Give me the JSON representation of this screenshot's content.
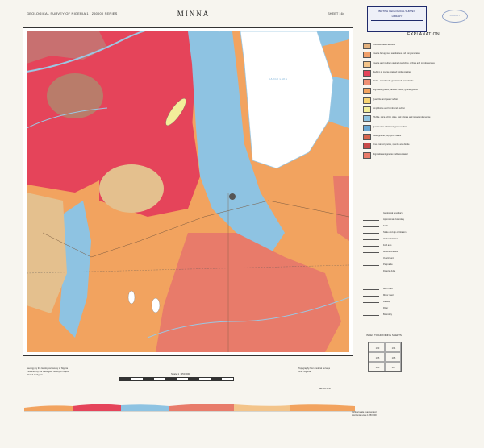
{
  "sheet": {
    "survey_title": "GEOLOGICAL SURVEY OF NIGERIA 1 : 250000 SERIES",
    "map_title": "MINNA",
    "sheet_number": "SHEET 164"
  },
  "stamp": {
    "line1": "BRITISH GEOLOGICAL SURVEY",
    "line2": "LIBRARY",
    "oval_text": "LIBRARY"
  },
  "map": {
    "lake_label": "KAINJI LAKE"
  },
  "explanation": {
    "title": "EXPLANATION",
    "units": [
      {
        "color": "#e4b27e",
        "text": "Unconsolidated alluvium"
      },
      {
        "color": "#f0a06a",
        "text": "Coarse ferruginous sandstones and conglomerates"
      },
      {
        "color": "#f3c48a",
        "text": "Coarse and medium grained quartzites, schists and conglomerates"
      },
      {
        "color": "#e5445a",
        "text": "Medium to coarse grained biotite granites"
      },
      {
        "color": "#ef8f73",
        "text": "Biotite - hornblende granite and granodiorite"
      },
      {
        "color": "#f2a35f",
        "text": "Migmatitic gneiss, banded gneiss, granite gneiss"
      },
      {
        "color": "#f8d472",
        "text": "Quartzite and quartz schist"
      },
      {
        "color": "#f3ee9a",
        "text": "Amphibolite and hornblende schist"
      },
      {
        "color": "#8ec3e2",
        "text": "Phyllite, mica schist, slate, calc silicate and metaconglomerate"
      },
      {
        "color": "#6aa7d3",
        "text": "Quartz mica schist and garnet schist"
      },
      {
        "color": "#d9664f",
        "text": "Older granite porphyritic facies"
      },
      {
        "color": "#c84a4a",
        "text": "Fine grained granite, syenite and diorite"
      },
      {
        "color": "#e87b6a",
        "text": "Migmatite and granite undifferentiated"
      }
    ]
  },
  "symbols": [
    {
      "text": "Geological boundary"
    },
    {
      "text": "Approximate boundary"
    },
    {
      "text": "Fault"
    },
    {
      "text": "Strike and dip of foliation"
    },
    {
      "text": "Vertical foliation"
    },
    {
      "text": "Fold axis"
    },
    {
      "text": "Mineral lineation"
    },
    {
      "text": "Quartz vein"
    },
    {
      "text": "Pegmatite"
    },
    {
      "text": "Dolerite dyke"
    }
  ],
  "roads": [
    {
      "text": "Main road"
    },
    {
      "text": "Minor road"
    },
    {
      "text": "Railway"
    },
    {
      "text": "River"
    },
    {
      "text": "Boundary"
    }
  ],
  "index": {
    "title": "INDEX TO ADJOINING SHEETS",
    "cells": [
      "163",
      "164",
      "165",
      "185",
      "186",
      "187"
    ]
  },
  "footer": {
    "left_line1": "Geology by the Geological Survey of Nigeria",
    "left_line2": "Published by the Geological Survey of Nigeria",
    "left_line3": "Printed in Nigeria",
    "right_line1": "Topography from Federal Surveys",
    "right_line2": "Grid: Nigerian",
    "scale_title": "Scale 1 : 250 000",
    "section_label": "Section A-B",
    "section_note_line1": "Vertical scale exaggerated",
    "section_note_line2": "Horizontal scale 1:250 000"
  },
  "colors": {
    "red_granite": "#e5445a",
    "pink": "#ef8f73",
    "orange": "#f2a35f",
    "light_orange": "#f3c48a",
    "blue": "#8ec3e2",
    "dark_blue": "#6aa7d3",
    "brown": "#b97c6a",
    "sand": "#e4c08e",
    "lake": "#ffffff",
    "river": "#9bc7e3"
  }
}
